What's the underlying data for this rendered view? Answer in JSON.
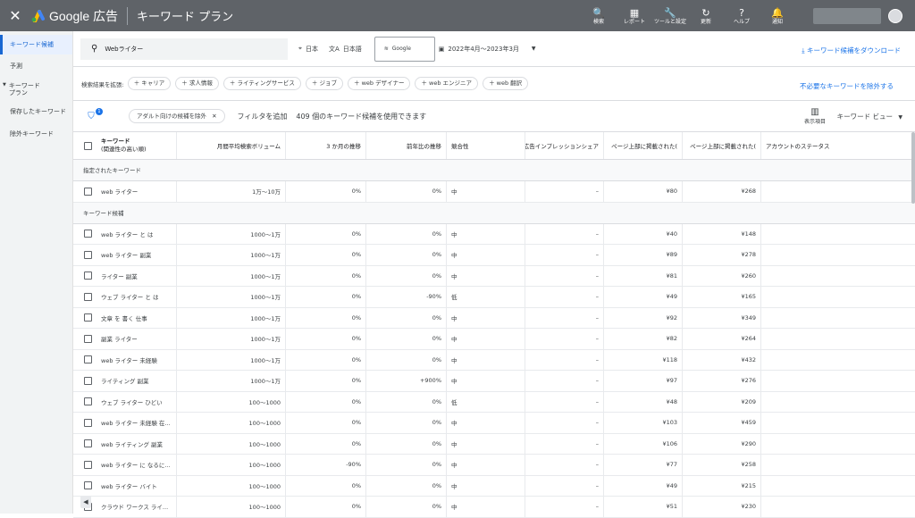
{
  "topbar": {
    "close_label": "✕",
    "brand": "Google 広告",
    "title": "キーワード プラン",
    "tools": [
      {
        "icon": "search-icon",
        "glyph": "🔍",
        "label": "検索"
      },
      {
        "icon": "report-icon",
        "glyph": "▦",
        "label": "レポート"
      },
      {
        "icon": "wrench-icon",
        "glyph": "🔧",
        "label": "ツールと設定"
      },
      {
        "icon": "refresh-icon",
        "glyph": "↻",
        "label": "更新"
      },
      {
        "icon": "help-icon",
        "glyph": "?",
        "label": "ヘルプ"
      },
      {
        "icon": "bell-icon",
        "glyph": "🔔",
        "label": "通知"
      }
    ]
  },
  "sidebar": {
    "items": [
      {
        "label": "キーワード候補"
      },
      {
        "label": "予測"
      },
      {
        "label": "キーワード プラン"
      },
      {
        "label": "保存したキーワード"
      },
      {
        "label": "除外キーワード"
      }
    ]
  },
  "filters": {
    "search_value": "Webライター",
    "location": "日本",
    "language": "日本語",
    "network": "Google",
    "date_range": "2022年4月〜2023年3月",
    "download_label": "キーワード候補をダウンロード",
    "broaden_label": "検索結果を拡張:",
    "broaden_chips": [
      "キャリア",
      "求人情報",
      "ライティングサービス",
      "ジョブ",
      "web デザイナー",
      "web エンジニア",
      "web 翻訳"
    ],
    "exclude_label": "不必要なキーワードを除外する",
    "adult_chip": "アダルト向けの候補を除外",
    "filter_badge": "1",
    "add_filter": "フィルタを追加",
    "count_text": "409 個のキーワード候補を使用できます",
    "columns_label": "表示項目",
    "view_label": "キーワード ビュー"
  },
  "table": {
    "headers": {
      "keyword": "キーワード",
      "keyword_sub": "(関連性の高い順)",
      "volume": "月間平均検索ボリューム",
      "three_month": "3 か月の推移",
      "yoy": "前年比の推移",
      "competition": "競合性",
      "impr_share": "広告インプレッションシェア",
      "bid_low": "ページ上部に掲載された(",
      "bid_high": "ページ上部に掲載された(",
      "status": "アカウントのステータス"
    },
    "provided_section": "指定されたキーワード",
    "provided": [
      [
        "web ライター",
        "1万〜10万",
        "0%",
        "0%",
        "中",
        "–",
        "¥80",
        "¥268",
        ""
      ]
    ],
    "ideas_section": "キーワード候補",
    "ideas": [
      [
        "web ライター と は",
        "1000〜1万",
        "0%",
        "0%",
        "中",
        "–",
        "¥40",
        "¥148",
        ""
      ],
      [
        "web ライター 副業",
        "1000〜1万",
        "0%",
        "0%",
        "中",
        "–",
        "¥89",
        "¥278",
        ""
      ],
      [
        "ライター 副業",
        "1000〜1万",
        "0%",
        "0%",
        "中",
        "–",
        "¥81",
        "¥260",
        ""
      ],
      [
        "ウェブ ライター と は",
        "1000〜1万",
        "0%",
        "-90%",
        "低",
        "–",
        "¥49",
        "¥165",
        ""
      ],
      [
        "文章 を 書く 仕事",
        "1000〜1万",
        "0%",
        "0%",
        "中",
        "–",
        "¥92",
        "¥349",
        ""
      ],
      [
        "副業 ライター",
        "1000〜1万",
        "0%",
        "0%",
        "中",
        "–",
        "¥82",
        "¥264",
        ""
      ],
      [
        "web ライター 未経験",
        "1000〜1万",
        "0%",
        "0%",
        "中",
        "–",
        "¥118",
        "¥432",
        ""
      ],
      [
        "ライティング 副業",
        "1000〜1万",
        "0%",
        "+900%",
        "中",
        "–",
        "¥97",
        "¥276",
        ""
      ],
      [
        "ウェブ ライター ひどい",
        "100〜1000",
        "0%",
        "0%",
        "低",
        "–",
        "¥48",
        "¥209",
        ""
      ],
      [
        "web ライター 未経験 在...",
        "100〜1000",
        "0%",
        "0%",
        "中",
        "–",
        "¥103",
        "¥459",
        ""
      ],
      [
        "web ライティング 副業",
        "100〜1000",
        "0%",
        "0%",
        "中",
        "–",
        "¥106",
        "¥290",
        ""
      ],
      [
        "web ライター に なるに...",
        "100〜1000",
        "-90%",
        "0%",
        "中",
        "–",
        "¥77",
        "¥258",
        ""
      ],
      [
        "web ライター バイト",
        "100〜1000",
        "0%",
        "0%",
        "中",
        "–",
        "¥49",
        "¥215",
        ""
      ],
      [
        "クラウド ワークス ライ...",
        "100〜1000",
        "0%",
        "0%",
        "中",
        "–",
        "¥51",
        "¥230",
        ""
      ]
    ]
  }
}
